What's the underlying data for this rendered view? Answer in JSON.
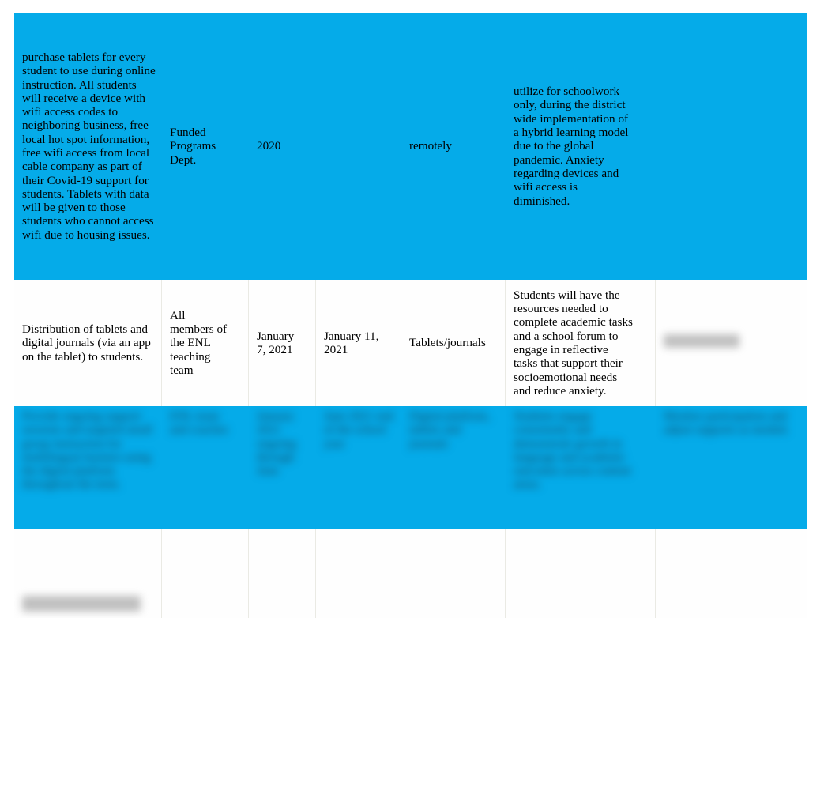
{
  "document": {
    "type": "action-plan-table",
    "background_color": "#FFFFFF",
    "accent_color": "#05ABE9",
    "highlight_row_color": "#05ABE9",
    "plain_row_color": "#FEFEFE"
  },
  "table": {
    "column_count": 7,
    "row_count": 4,
    "rows": [
      {
        "id": "row-1",
        "style": "highlighted",
        "legible": true,
        "cells": [
          {
            "col": 1,
            "text": "purchase tablets for every student to use during online instruction. All students will receive a device with      wifi access codes to neighboring business, free local hot spot information, free wifi access from local cable company as part of their Covid-19 support for students. Tablets with data      will be given to those students who cannot access wifi due to housing issues.",
            "blurred": false
          },
          {
            "col": 2,
            "text": "Funded Programs Dept.",
            "blurred": false
          },
          {
            "col": 3,
            "text": "2020",
            "blurred": false
          },
          {
            "col": 4,
            "text": "",
            "blurred": false
          },
          {
            "col": 5,
            "text": "remotely",
            "blurred": false
          },
          {
            "col": 6,
            "text": "utilize for schoolwork only, during the district wide implementation of a hybrid learning model due to the global pandemic. Anxiety regarding devices and wifi access is diminished.",
            "blurred": false
          },
          {
            "col": 7,
            "text": "",
            "blurred": false
          }
        ]
      },
      {
        "id": "row-2",
        "style": "plain",
        "legible": true,
        "cells": [
          {
            "col": 1,
            "text": "Distribution of tablets and digital journals (via an app on the tablet) to students.",
            "blurred": false
          },
          {
            "col": 2,
            "text": "All members of the ENL teaching team",
            "blurred": false
          },
          {
            "col": 3,
            "text": "January 7, 2021",
            "blurred": false
          },
          {
            "col": 4,
            "text": "January 11, 2021",
            "blurred": false
          },
          {
            "col": 5,
            "text": "Tablets/journals",
            "blurred": false
          },
          {
            "col": 6,
            "text": "Students will have the resources needed to complete academic tasks and a school forum to engage in reflective tasks that support their socioemotional needs and reduce anxiety.",
            "blurred": false
          },
          {
            "col": 7,
            "text": "",
            "blurred": true,
            "redacted_label": "illegible"
          }
        ]
      },
      {
        "id": "row-3",
        "style": "highlighted",
        "legible": false,
        "note": "content obscured by blur",
        "cells": [
          {
            "col": 1,
            "text": "",
            "blurred": true
          },
          {
            "col": 2,
            "text": "",
            "blurred": true
          },
          {
            "col": 3,
            "text": "",
            "blurred": true
          },
          {
            "col": 4,
            "text": "",
            "blurred": true
          },
          {
            "col": 5,
            "text": "",
            "blurred": true
          },
          {
            "col": 6,
            "text": "",
            "blurred": true
          },
          {
            "col": 7,
            "text": "",
            "blurred": true
          }
        ]
      },
      {
        "id": "row-4",
        "style": "plain",
        "legible": false,
        "note": "mostly empty; single obscured label at left",
        "cells": [
          {
            "col": 1,
            "text": "",
            "blurred": true,
            "redacted_label": "illegible"
          },
          {
            "col": 2,
            "text": "",
            "blurred": false
          },
          {
            "col": 3,
            "text": "",
            "blurred": false
          },
          {
            "col": 4,
            "text": "",
            "blurred": false
          },
          {
            "col": 5,
            "text": "",
            "blurred": false
          },
          {
            "col": 6,
            "text": "",
            "blurred": false
          },
          {
            "col": 7,
            "text": "",
            "blurred": false
          }
        ]
      }
    ]
  }
}
